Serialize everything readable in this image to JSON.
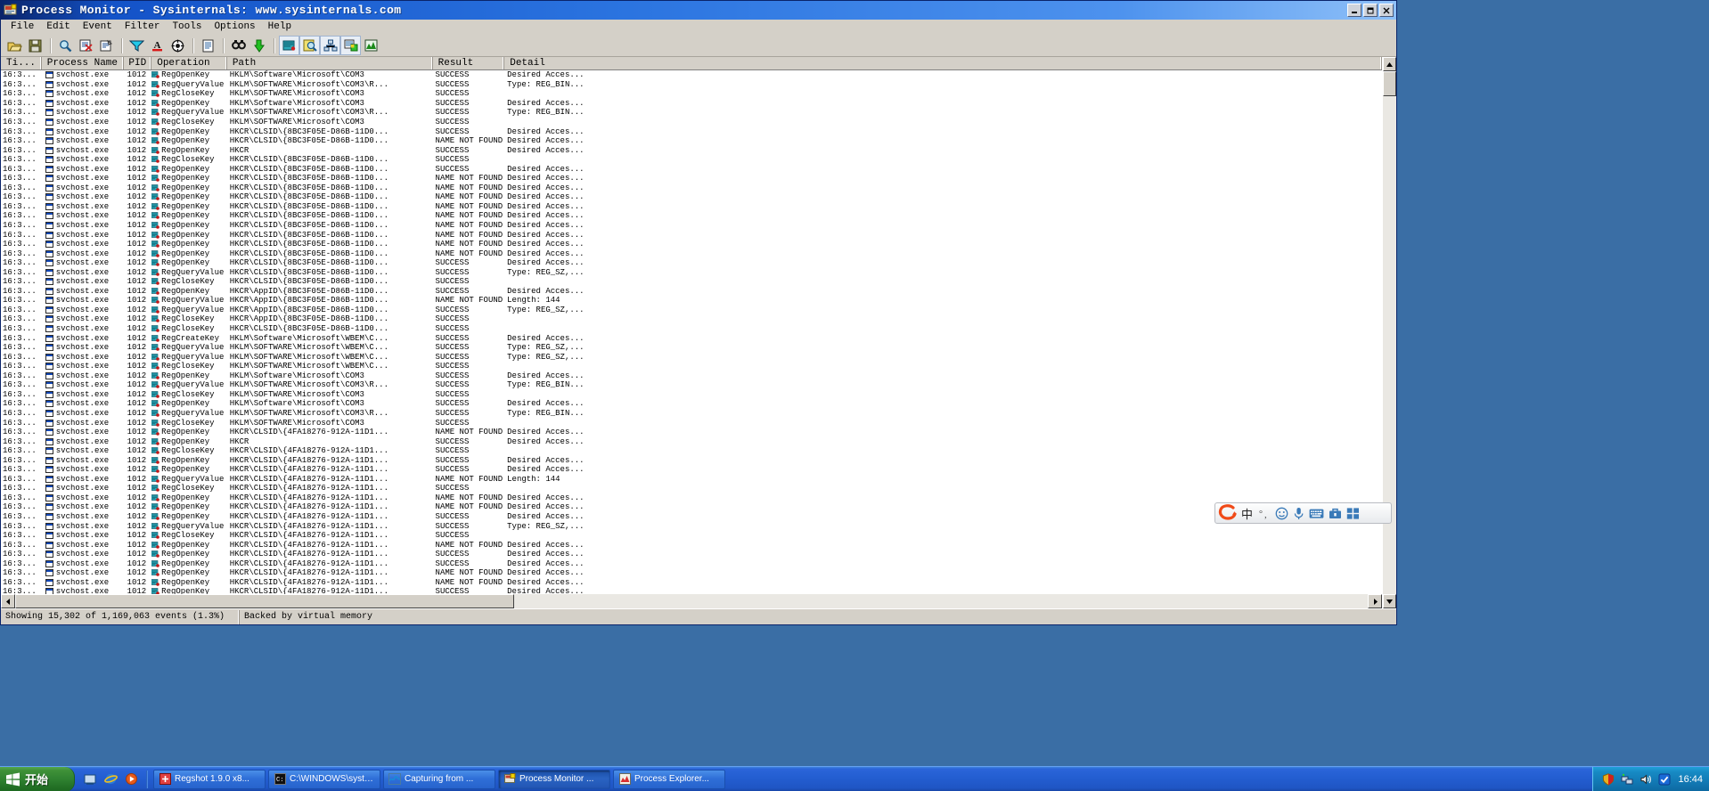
{
  "window": {
    "title": "Process Monitor - Sysinternals: www.sysinternals.com",
    "icon": "process-monitor-icon",
    "buttons": {
      "minimize": "minimize",
      "maximize": "maximize",
      "close": "close"
    }
  },
  "menu": [
    {
      "label": "File",
      "accel": "F"
    },
    {
      "label": "Edit",
      "accel": "E"
    },
    {
      "label": "Event",
      "accel": "v"
    },
    {
      "label": "Filter",
      "accel": "l"
    },
    {
      "label": "Tools",
      "accel": "T"
    },
    {
      "label": "Options",
      "accel": "O"
    },
    {
      "label": "Help",
      "accel": "H"
    }
  ],
  "toolbar": [
    {
      "name": "open-icon"
    },
    {
      "name": "save-icon"
    },
    {
      "name": "separator"
    },
    {
      "name": "capture-icon"
    },
    {
      "name": "autoscroll-icon"
    },
    {
      "name": "clear-icon"
    },
    {
      "name": "separator"
    },
    {
      "name": "filter-icon"
    },
    {
      "name": "highlight-icon"
    },
    {
      "name": "include-process-icon"
    },
    {
      "name": "separator"
    },
    {
      "name": "jump-to-icon"
    },
    {
      "name": "separator"
    },
    {
      "name": "find-icon"
    },
    {
      "name": "process-tree-icon"
    },
    {
      "name": "separator"
    },
    {
      "name": "show-registry-activity-icon",
      "boxed": true
    },
    {
      "name": "show-file-activity-icon",
      "boxed": true
    },
    {
      "name": "show-network-activity-icon",
      "boxed": true
    },
    {
      "name": "show-process-activity-icon",
      "boxed": true
    },
    {
      "name": "show-profiling-events-icon"
    }
  ],
  "columns": [
    {
      "key": "time",
      "label": "Ti...",
      "cls": "c-time"
    },
    {
      "key": "proc",
      "label": "Process Name",
      "cls": "c-proc"
    },
    {
      "key": "pid",
      "label": "PID",
      "cls": "c-pid"
    },
    {
      "key": "op",
      "label": "Operation",
      "cls": "c-op"
    },
    {
      "key": "path",
      "label": "Path",
      "cls": "c-path"
    },
    {
      "key": "result",
      "label": "Result",
      "cls": "c-res"
    },
    {
      "key": "detail",
      "label": "Detail",
      "cls": "c-det"
    }
  ],
  "common": {
    "time": "16:3...",
    "process": "svchost.exe",
    "pid": "1012",
    "path_clsid_1": "HKCR\\CLSID\\{8BC3F05E-D86B-11D0...",
    "path_clsid_2": "HKCR\\CLSID\\{4FA18276-912A-11D1...",
    "path_appid_1": "HKCR\\AppID\\{8BC3F05E-D86B-11D0...",
    "path_com3_sw": "HKLM\\Software\\Microsoft\\COM3",
    "path_com3_SW": "HKLM\\SOFTWARE\\Microsoft\\COM3",
    "path_com3_R": "HKLM\\SOFTWARE\\Microsoft\\COM3\\R...",
    "path_hkcr": "HKCR",
    "path_wbem": "HKLM\\Software\\Microsoft\\WBEM\\C...",
    "path_wbem_SW": "HKLM\\SOFTWARE\\Microsoft\\WBEM\\C...",
    "res_success": "SUCCESS",
    "res_notfound": "NAME NOT FOUND",
    "det_access": "Desired Acces...",
    "det_bin": "Type: REG_BIN...",
    "det_sz": "Type: REG_SZ,...",
    "det_len": "Length: 144",
    "op_open": "RegOpenKey",
    "op_query": "RegQueryValue",
    "op_close": "RegCloseKey",
    "op_create": "RegCreateKey"
  },
  "rows": [
    {
      "op": "RegOpenKey",
      "path": "HKLM\\Software\\Microsoft\\COM3",
      "result": "SUCCESS",
      "detail": "Desired Acces..."
    },
    {
      "op": "RegQueryValue",
      "path": "HKLM\\SOFTWARE\\Microsoft\\COM3\\R...",
      "result": "SUCCESS",
      "detail": "Type: REG_BIN..."
    },
    {
      "op": "RegCloseKey",
      "path": "HKLM\\SOFTWARE\\Microsoft\\COM3",
      "result": "SUCCESS",
      "detail": ""
    },
    {
      "op": "RegOpenKey",
      "path": "HKLM\\Software\\Microsoft\\COM3",
      "result": "SUCCESS",
      "detail": "Desired Acces..."
    },
    {
      "op": "RegQueryValue",
      "path": "HKLM\\SOFTWARE\\Microsoft\\COM3\\R...",
      "result": "SUCCESS",
      "detail": "Type: REG_BIN..."
    },
    {
      "op": "RegCloseKey",
      "path": "HKLM\\SOFTWARE\\Microsoft\\COM3",
      "result": "SUCCESS",
      "detail": ""
    },
    {
      "op": "RegOpenKey",
      "path": "HKCR\\CLSID\\{8BC3F05E-D86B-11D0...",
      "result": "SUCCESS",
      "detail": "Desired Acces..."
    },
    {
      "op": "RegOpenKey",
      "path": "HKCR\\CLSID\\{8BC3F05E-D86B-11D0...",
      "result": "NAME NOT FOUND",
      "detail": "Desired Acces..."
    },
    {
      "op": "RegOpenKey",
      "path": "HKCR",
      "result": "SUCCESS",
      "detail": "Desired Acces..."
    },
    {
      "op": "RegCloseKey",
      "path": "HKCR\\CLSID\\{8BC3F05E-D86B-11D0...",
      "result": "SUCCESS",
      "detail": ""
    },
    {
      "op": "RegOpenKey",
      "path": "HKCR\\CLSID\\{8BC3F05E-D86B-11D0...",
      "result": "SUCCESS",
      "detail": "Desired Acces..."
    },
    {
      "op": "RegOpenKey",
      "path": "HKCR\\CLSID\\{8BC3F05E-D86B-11D0...",
      "result": "NAME NOT FOUND",
      "detail": "Desired Acces..."
    },
    {
      "op": "RegOpenKey",
      "path": "HKCR\\CLSID\\{8BC3F05E-D86B-11D0...",
      "result": "NAME NOT FOUND",
      "detail": "Desired Acces..."
    },
    {
      "op": "RegOpenKey",
      "path": "HKCR\\CLSID\\{8BC3F05E-D86B-11D0...",
      "result": "NAME NOT FOUND",
      "detail": "Desired Acces..."
    },
    {
      "op": "RegOpenKey",
      "path": "HKCR\\CLSID\\{8BC3F05E-D86B-11D0...",
      "result": "NAME NOT FOUND",
      "detail": "Desired Acces..."
    },
    {
      "op": "RegOpenKey",
      "path": "HKCR\\CLSID\\{8BC3F05E-D86B-11D0...",
      "result": "NAME NOT FOUND",
      "detail": "Desired Acces..."
    },
    {
      "op": "RegOpenKey",
      "path": "HKCR\\CLSID\\{8BC3F05E-D86B-11D0...",
      "result": "NAME NOT FOUND",
      "detail": "Desired Acces..."
    },
    {
      "op": "RegOpenKey",
      "path": "HKCR\\CLSID\\{8BC3F05E-D86B-11D0...",
      "result": "NAME NOT FOUND",
      "detail": "Desired Acces..."
    },
    {
      "op": "RegOpenKey",
      "path": "HKCR\\CLSID\\{8BC3F05E-D86B-11D0...",
      "result": "NAME NOT FOUND",
      "detail": "Desired Acces..."
    },
    {
      "op": "RegOpenKey",
      "path": "HKCR\\CLSID\\{8BC3F05E-D86B-11D0...",
      "result": "NAME NOT FOUND",
      "detail": "Desired Acces..."
    },
    {
      "op": "RegOpenKey",
      "path": "HKCR\\CLSID\\{8BC3F05E-D86B-11D0...",
      "result": "SUCCESS",
      "detail": "Desired Acces..."
    },
    {
      "op": "RegQueryValue",
      "path": "HKCR\\CLSID\\{8BC3F05E-D86B-11D0...",
      "result": "SUCCESS",
      "detail": "Type: REG_SZ,..."
    },
    {
      "op": "RegCloseKey",
      "path": "HKCR\\CLSID\\{8BC3F05E-D86B-11D0...",
      "result": "SUCCESS",
      "detail": ""
    },
    {
      "op": "RegOpenKey",
      "path": "HKCR\\AppID\\{8BC3F05E-D86B-11D0...",
      "result": "SUCCESS",
      "detail": "Desired Acces..."
    },
    {
      "op": "RegQueryValue",
      "path": "HKCR\\AppID\\{8BC3F05E-D86B-11D0...",
      "result": "NAME NOT FOUND",
      "detail": "Length: 144"
    },
    {
      "op": "RegQueryValue",
      "path": "HKCR\\AppID\\{8BC3F05E-D86B-11D0...",
      "result": "SUCCESS",
      "detail": "Type: REG_SZ,..."
    },
    {
      "op": "RegCloseKey",
      "path": "HKCR\\AppID\\{8BC3F05E-D86B-11D0...",
      "result": "SUCCESS",
      "detail": ""
    },
    {
      "op": "RegCloseKey",
      "path": "HKCR\\CLSID\\{8BC3F05E-D86B-11D0...",
      "result": "SUCCESS",
      "detail": ""
    },
    {
      "op": "RegCreateKey",
      "path": "HKLM\\Software\\Microsoft\\WBEM\\C...",
      "result": "SUCCESS",
      "detail": "Desired Acces..."
    },
    {
      "op": "RegQueryValue",
      "path": "HKLM\\SOFTWARE\\Microsoft\\WBEM\\C...",
      "result": "SUCCESS",
      "detail": "Type: REG_SZ,..."
    },
    {
      "op": "RegQueryValue",
      "path": "HKLM\\SOFTWARE\\Microsoft\\WBEM\\C...",
      "result": "SUCCESS",
      "detail": "Type: REG_SZ,..."
    },
    {
      "op": "RegCloseKey",
      "path": "HKLM\\SOFTWARE\\Microsoft\\WBEM\\C...",
      "result": "SUCCESS",
      "detail": ""
    },
    {
      "op": "RegOpenKey",
      "path": "HKLM\\Software\\Microsoft\\COM3",
      "result": "SUCCESS",
      "detail": "Desired Acces..."
    },
    {
      "op": "RegQueryValue",
      "path": "HKLM\\SOFTWARE\\Microsoft\\COM3\\R...",
      "result": "SUCCESS",
      "detail": "Type: REG_BIN..."
    },
    {
      "op": "RegCloseKey",
      "path": "HKLM\\SOFTWARE\\Microsoft\\COM3",
      "result": "SUCCESS",
      "detail": ""
    },
    {
      "op": "RegOpenKey",
      "path": "HKLM\\Software\\Microsoft\\COM3",
      "result": "SUCCESS",
      "detail": "Desired Acces..."
    },
    {
      "op": "RegQueryValue",
      "path": "HKLM\\SOFTWARE\\Microsoft\\COM3\\R...",
      "result": "SUCCESS",
      "detail": "Type: REG_BIN..."
    },
    {
      "op": "RegCloseKey",
      "path": "HKLM\\SOFTWARE\\Microsoft\\COM3",
      "result": "SUCCESS",
      "detail": ""
    },
    {
      "op": "RegOpenKey",
      "path": "HKCR\\CLSID\\{4FA18276-912A-11D1...",
      "result": "NAME NOT FOUND",
      "detail": "Desired Acces..."
    },
    {
      "op": "RegOpenKey",
      "path": "HKCR",
      "result": "SUCCESS",
      "detail": "Desired Acces..."
    },
    {
      "op": "RegCloseKey",
      "path": "HKCR\\CLSID\\{4FA18276-912A-11D1...",
      "result": "SUCCESS",
      "detail": ""
    },
    {
      "op": "RegOpenKey",
      "path": "HKCR\\CLSID\\{4FA18276-912A-11D1...",
      "result": "SUCCESS",
      "detail": "Desired Acces..."
    },
    {
      "op": "RegOpenKey",
      "path": "HKCR\\CLSID\\{4FA18276-912A-11D1...",
      "result": "SUCCESS",
      "detail": "Desired Acces..."
    },
    {
      "op": "RegQueryValue",
      "path": "HKCR\\CLSID\\{4FA18276-912A-11D1...",
      "result": "NAME NOT FOUND",
      "detail": "Length: 144"
    },
    {
      "op": "RegCloseKey",
      "path": "HKCR\\CLSID\\{4FA18276-912A-11D1...",
      "result": "SUCCESS",
      "detail": ""
    },
    {
      "op": "RegOpenKey",
      "path": "HKCR\\CLSID\\{4FA18276-912A-11D1...",
      "result": "NAME NOT FOUND",
      "detail": "Desired Acces..."
    },
    {
      "op": "RegOpenKey",
      "path": "HKCR\\CLSID\\{4FA18276-912A-11D1...",
      "result": "NAME NOT FOUND",
      "detail": "Desired Acces..."
    },
    {
      "op": "RegOpenKey",
      "path": "HKCR\\CLSID\\{4FA18276-912A-11D1...",
      "result": "SUCCESS",
      "detail": "Desired Acces..."
    },
    {
      "op": "RegQueryValue",
      "path": "HKCR\\CLSID\\{4FA18276-912A-11D1...",
      "result": "SUCCESS",
      "detail": "Type: REG_SZ,..."
    },
    {
      "op": "RegCloseKey",
      "path": "HKCR\\CLSID\\{4FA18276-912A-11D1...",
      "result": "SUCCESS",
      "detail": ""
    },
    {
      "op": "RegOpenKey",
      "path": "HKCR\\CLSID\\{4FA18276-912A-11D1...",
      "result": "NAME NOT FOUND",
      "detail": "Desired Acces..."
    },
    {
      "op": "RegOpenKey",
      "path": "HKCR\\CLSID\\{4FA18276-912A-11D1...",
      "result": "SUCCESS",
      "detail": "Desired Acces..."
    },
    {
      "op": "RegOpenKey",
      "path": "HKCR\\CLSID\\{4FA18276-912A-11D1...",
      "result": "SUCCESS",
      "detail": "Desired Acces..."
    },
    {
      "op": "RegOpenKey",
      "path": "HKCR\\CLSID\\{4FA18276-912A-11D1...",
      "result": "NAME NOT FOUND",
      "detail": "Desired Acces..."
    },
    {
      "op": "RegOpenKey",
      "path": "HKCR\\CLSID\\{4FA18276-912A-11D1...",
      "result": "NAME NOT FOUND",
      "detail": "Desired Acces..."
    },
    {
      "op": "RegOpenKey",
      "path": "HKCR\\CLSID\\{4FA18276-912A-11D1...",
      "result": "SUCCESS",
      "detail": "Desired Acces..."
    }
  ],
  "statusbar": {
    "events": "Showing 15,302 of 1,169,063 events (1.3%)",
    "backing": "Backed by virtual memory"
  },
  "ime": {
    "logo": "sogou-logo-icon",
    "mode": "中",
    "punctuation": "comma-period-icon",
    "emoji": "smiley-icon",
    "voice": "microphone-icon",
    "keyboard": "soft-keyboard-icon",
    "toolbox": "toolbox-icon",
    "menu": "menu-icon"
  },
  "taskbar": {
    "start": "开始",
    "quicklaunch": [
      {
        "name": "show-desktop-icon"
      },
      {
        "name": "internet-explorer-icon"
      },
      {
        "name": "media-player-icon"
      }
    ],
    "buttons": [
      {
        "label": "Regshot 1.9.0 x8...",
        "icon": "regshot-icon",
        "active": false
      },
      {
        "label": "C:\\WINDOWS\\syste...",
        "icon": "console-icon",
        "active": false
      },
      {
        "label": "Capturing from ...",
        "icon": "wireshark-icon",
        "active": false
      },
      {
        "label": "Process Monitor ...",
        "icon": "process-monitor-icon",
        "active": true
      },
      {
        "label": "Process Explorer...",
        "icon": "process-explorer-icon",
        "active": false
      }
    ],
    "tray": [
      {
        "name": "shield-icon"
      },
      {
        "name": "network-icon"
      },
      {
        "name": "volume-icon"
      },
      {
        "name": "antivirus-icon"
      }
    ],
    "clock": "16:44"
  }
}
